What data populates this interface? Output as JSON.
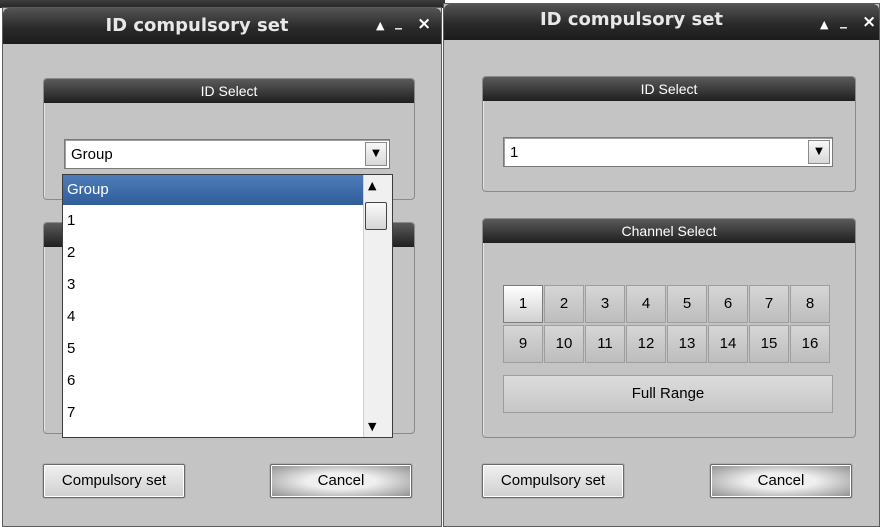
{
  "left_dialog": {
    "title": "ID compulsory set",
    "controls": {
      "restore": "▲",
      "minimize": "_",
      "close": "×"
    },
    "id_select": {
      "header": "ID Select",
      "selected": "Group",
      "dropdown_options": [
        "Group",
        "1",
        "2",
        "3",
        "4",
        "5",
        "6",
        "7"
      ]
    },
    "buttons": {
      "compulsory": "Compulsory set",
      "cancel": "Cancel"
    }
  },
  "right_dialog": {
    "title": "ID compulsory set",
    "controls": {
      "restore": "▲",
      "minimize": "_",
      "close": "×"
    },
    "id_select": {
      "header": "ID Select",
      "selected": "1"
    },
    "channel_select": {
      "header": "Channel Select",
      "channels": [
        "1",
        "2",
        "3",
        "4",
        "5",
        "6",
        "7",
        "8",
        "9",
        "10",
        "11",
        "12",
        "13",
        "14",
        "15",
        "16"
      ],
      "active_channel": "1",
      "full_range_label": "Full Range"
    },
    "buttons": {
      "compulsory": "Compulsory set",
      "cancel": "Cancel"
    }
  },
  "colors": {
    "title_bar": "#1c1c1c",
    "panel_bg": "#c4c4c4",
    "selection": "#3b6aa8"
  },
  "icons": {
    "restore": "triangle-up-icon",
    "minimize": "minimize-icon",
    "close": "close-icon",
    "dropdown": "chevron-down-icon"
  }
}
